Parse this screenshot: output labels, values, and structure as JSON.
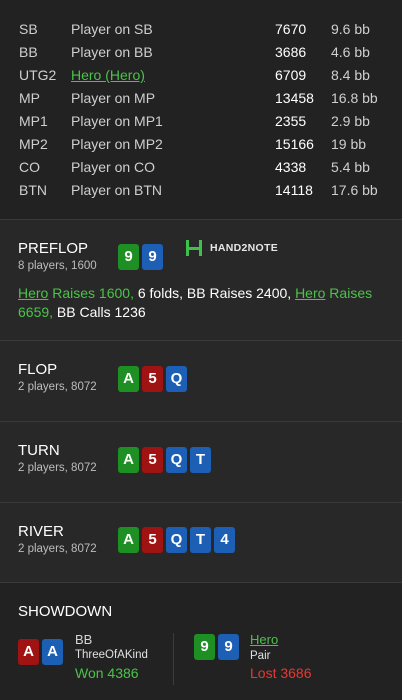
{
  "players": [
    {
      "pos": "SB",
      "name": "Player on SB",
      "stack": "7670",
      "bb": "9.6 bb",
      "hero": false
    },
    {
      "pos": "BB",
      "name": "Player on BB",
      "stack": "3686",
      "bb": "4.6 bb",
      "hero": false
    },
    {
      "pos": "UTG2",
      "name": "Hero (Hero)",
      "stack": "6709",
      "bb": "8.4 bb",
      "hero": true
    },
    {
      "pos": "MP",
      "name": "Player on MP",
      "stack": "13458",
      "bb": "16.8 bb",
      "hero": false
    },
    {
      "pos": "MP1",
      "name": "Player on MP1",
      "stack": "2355",
      "bb": "2.9 bb",
      "hero": false
    },
    {
      "pos": "MP2",
      "name": "Player on MP2",
      "stack": "15166",
      "bb": "19 bb",
      "hero": false
    },
    {
      "pos": "CO",
      "name": "Player on CO",
      "stack": "4338",
      "bb": "5.4 bb",
      "hero": false
    },
    {
      "pos": "BTN",
      "name": "Player on BTN",
      "stack": "14118",
      "bb": "17.6 bb",
      "hero": false
    }
  ],
  "preflop": {
    "title": "PREFLOP",
    "sub": "8 players, 1600",
    "cards": [
      {
        "rank": "9",
        "color": "green"
      },
      {
        "rank": "9",
        "color": "blue"
      }
    ],
    "logo": "HAND2NOTE",
    "actions": [
      {
        "text": "Hero",
        "style": "hero"
      },
      {
        "text": " Raises 1600,",
        "style": "green"
      },
      {
        "text": " 6 folds, BB ",
        "style": "white"
      },
      {
        "text": "Raises 2400,",
        "style": "white"
      },
      {
        "text": " ",
        "style": "white"
      },
      {
        "text": "Hero",
        "style": "hero"
      },
      {
        "text": " Raises 6659,",
        "style": "green"
      },
      {
        "text": " BB ",
        "style": "white"
      },
      {
        "text": "Calls 1236",
        "style": "white"
      }
    ]
  },
  "flop": {
    "title": "FLOP",
    "sub": "2 players, 8072",
    "cards": [
      {
        "rank": "A",
        "color": "green"
      },
      {
        "rank": "5",
        "color": "red"
      },
      {
        "rank": "Q",
        "color": "blue"
      }
    ]
  },
  "turn": {
    "title": "TURN",
    "sub": "2 players, 8072",
    "cards": [
      {
        "rank": "A",
        "color": "green"
      },
      {
        "rank": "5",
        "color": "red"
      },
      {
        "rank": "Q",
        "color": "blue"
      },
      {
        "rank": "T",
        "color": "blue"
      }
    ]
  },
  "river": {
    "title": "RIVER",
    "sub": "2 players, 8072",
    "cards": [
      {
        "rank": "A",
        "color": "green"
      },
      {
        "rank": "5",
        "color": "red"
      },
      {
        "rank": "Q",
        "color": "blue"
      },
      {
        "rank": "T",
        "color": "blue"
      },
      {
        "rank": "4",
        "color": "blue"
      }
    ]
  },
  "showdown": {
    "title": "SHOWDOWN",
    "left": {
      "cards": [
        {
          "rank": "A",
          "color": "red"
        },
        {
          "rank": "A",
          "color": "blue"
        }
      ],
      "name": "BB",
      "hand": "ThreeOfAKind",
      "result": "Won 4386"
    },
    "right": {
      "cards": [
        {
          "rank": "9",
          "color": "green"
        },
        {
          "rank": "9",
          "color": "blue"
        }
      ],
      "name": "Hero",
      "hand": "Pair",
      "result": "Lost 3686"
    }
  },
  "colors": {
    "green_card": "#1e8f22",
    "red_card": "#a01313",
    "blue_card": "#1c5fb4",
    "hero": "#4bc34a",
    "won": "#4bc34a",
    "lost": "#e53935"
  }
}
